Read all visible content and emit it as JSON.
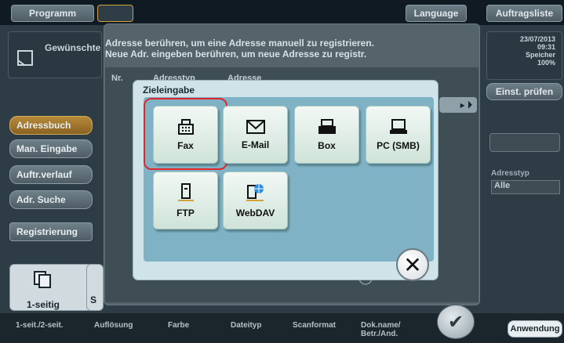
{
  "top_bar": {
    "program": "Programm",
    "language": "Language",
    "job_list": "Auftragsliste"
  },
  "header": {
    "title_fragment": "Gewünschte",
    "instruction_line1": "Adresse berühren, um eine Adresse manuell zu registrieren.",
    "instruction_line2": "Neue Adr. eingeben berühren, um neue Adresse zu registr."
  },
  "status": {
    "date": "23/07/2013",
    "time": "09:31",
    "memory_label": "Speicher",
    "memory_value": "100%",
    "check_settings": "Einst. prüfen"
  },
  "left_menu": [
    {
      "label": "Adressbuch"
    },
    {
      "label": "Man. Eingabe"
    },
    {
      "label": "Auftr.verlauf"
    },
    {
      "label": "Adr. Suche"
    },
    {
      "label": "Registrierung"
    }
  ],
  "list_columns": {
    "nr": "Nr.",
    "address_type": "Adresstyp",
    "address": "Adresse"
  },
  "filter": {
    "type_label": "Adresstyp",
    "type_value": "Alle"
  },
  "dialog": {
    "title": "Zieleingabe",
    "tiles": [
      {
        "label": "Fax",
        "icon": "fax-icon"
      },
      {
        "label": "E-Mail",
        "icon": "envelope-icon"
      },
      {
        "label": "Box",
        "icon": "box-icon"
      },
      {
        "label": "PC (SMB)",
        "icon": "computer-icon"
      },
      {
        "label": "FTP",
        "icon": "ftp-server-icon"
      },
      {
        "label": "WebDAV",
        "icon": "webdav-icon"
      }
    ]
  },
  "bottom": {
    "setting_value": "1-seitig",
    "setting_partial": "S",
    "labels": [
      "1-seit./2-seit.",
      "Auflösung",
      "Farbe",
      "Dateityp",
      "Scanformat",
      "Dok.name/ Betr./And."
    ],
    "apply": "Anwendung"
  },
  "colors": {
    "highlight_ring": "#e0262b",
    "active_menu": "#b78a3a",
    "dialog_bg": "#cfe3e9"
  }
}
